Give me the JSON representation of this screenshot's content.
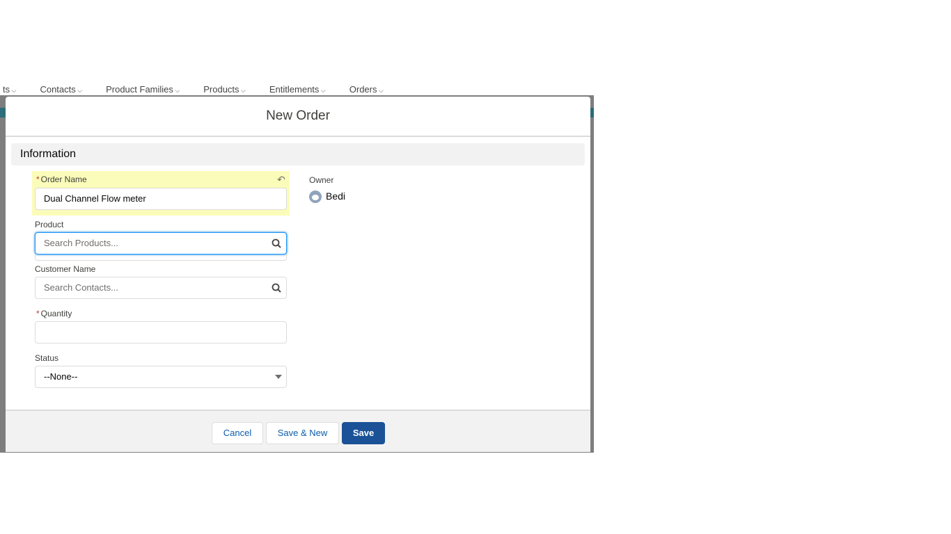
{
  "background_nav": [
    "ts",
    "Contacts",
    "Product Families",
    "Products",
    "Entitlements",
    "Orders"
  ],
  "modal": {
    "title": "New Order",
    "section": "Information",
    "fields": {
      "order_name": {
        "label": "Order Name",
        "required": "*",
        "value": "Dual Channel Flow meter"
      },
      "product": {
        "label": "Product",
        "placeholder": "Search Products..."
      },
      "customer_name": {
        "label": "Customer Name",
        "placeholder": "Search Contacts..."
      },
      "quantity": {
        "label": "Quantity",
        "required": "*",
        "value": ""
      },
      "status": {
        "label": "Status",
        "value": "--None--"
      },
      "owner": {
        "label": "Owner",
        "value": "Bedi"
      }
    },
    "buttons": {
      "cancel": "Cancel",
      "save_new": "Save & New",
      "save": "Save"
    }
  },
  "colors": {
    "brand": "#1b5297",
    "highlight": "#fbfcb9",
    "focus": "#1b96ff"
  }
}
